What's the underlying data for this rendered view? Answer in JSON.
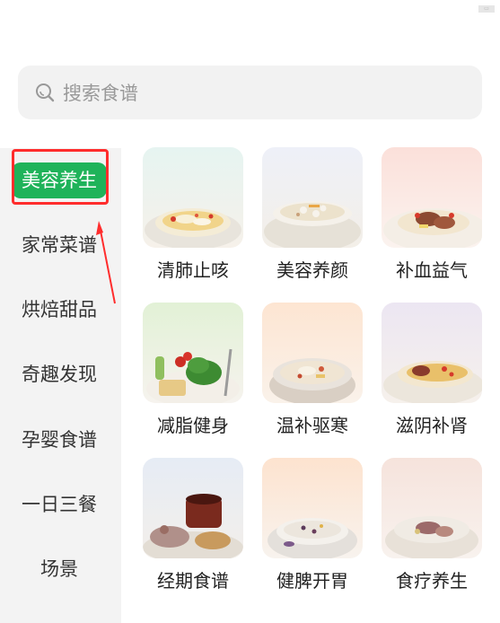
{
  "search": {
    "placeholder": "搜索食谱"
  },
  "sidebar": {
    "items": [
      {
        "label": "美容养生",
        "active": true
      },
      {
        "label": "家常菜谱",
        "active": false
      },
      {
        "label": "烘焙甜品",
        "active": false
      },
      {
        "label": "奇趣发现",
        "active": false
      },
      {
        "label": "孕婴食谱",
        "active": false
      },
      {
        "label": "一日三餐",
        "active": false
      },
      {
        "label": "场景",
        "active": false
      }
    ]
  },
  "recipes": [
    {
      "label": "清肺止咳",
      "icon": "bowl-of-pear-soup-image"
    },
    {
      "label": "美容养颜",
      "icon": "bowl-of-dessert-soup-image"
    },
    {
      "label": "补血益气",
      "icon": "plate-of-meat-soup-image"
    },
    {
      "label": "减脂健身",
      "icon": "salad-plate-image"
    },
    {
      "label": "温补驱寒",
      "icon": "clay-pot-soup-image"
    },
    {
      "label": "滋阴补肾",
      "icon": "clear-broth-soup-image"
    },
    {
      "label": "经期食谱",
      "icon": "herbal-drink-image"
    },
    {
      "label": "健脾开胃",
      "icon": "grain-porridge-image"
    },
    {
      "label": "食疗养生",
      "icon": "pork-rib-soup-image"
    }
  ],
  "colors": {
    "accent": "#1fb35a",
    "highlight": "#ff2d2d"
  }
}
